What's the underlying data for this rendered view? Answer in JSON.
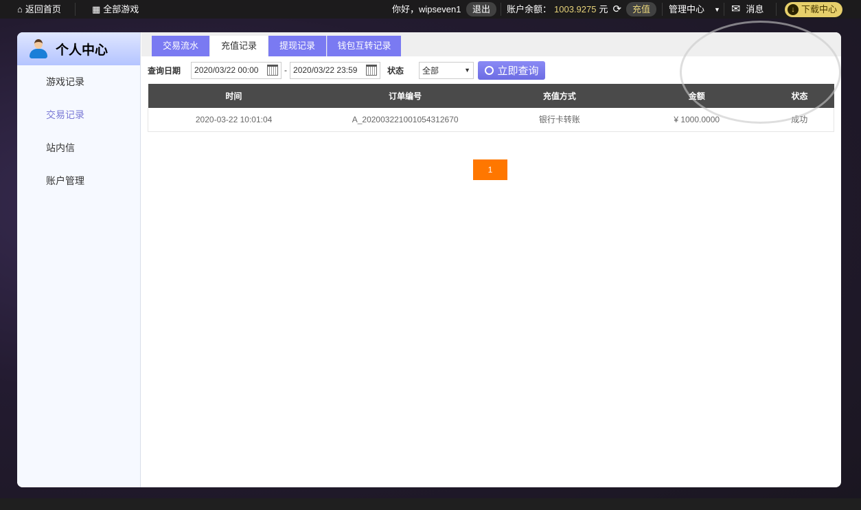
{
  "topbar": {
    "home": "返回首页",
    "all_games": "全部游戏",
    "greeting": "你好，wipseven1",
    "logout": "退出",
    "balance_label": "账户余额：",
    "balance": "1003.9275",
    "currency": "元",
    "recharge": "充值",
    "manage": "管理中心",
    "messages": "消息",
    "download": "下载中心"
  },
  "sidebar": {
    "title": "个人中心",
    "items": [
      {
        "label": "游戏记录"
      },
      {
        "label": "交易记录"
      },
      {
        "label": "站内信"
      },
      {
        "label": "账户管理"
      }
    ]
  },
  "tabs": [
    {
      "label": "交易流水"
    },
    {
      "label": "充值记录"
    },
    {
      "label": "提现记录"
    },
    {
      "label": "钱包互转记录"
    }
  ],
  "filter": {
    "date_label": "查询日期",
    "start": "2020/03/22 00:00",
    "sep": "-",
    "end": "2020/03/22 23:59",
    "status_label": "状态",
    "status_value": "全部",
    "query": "立即查询"
  },
  "table": {
    "headers": [
      "时间",
      "订单编号",
      "充值方式",
      "金额",
      "状态"
    ],
    "rows": [
      [
        "2020-03-22 10:01:04",
        "A_202003221001054312670",
        "银行卡转账",
        "¥ 1000.0000",
        "成功"
      ]
    ]
  },
  "pagination": {
    "current": "1"
  },
  "colors": {
    "accent": "#7a7af2",
    "page": "#ff7700",
    "balance": "#e7d37a"
  }
}
